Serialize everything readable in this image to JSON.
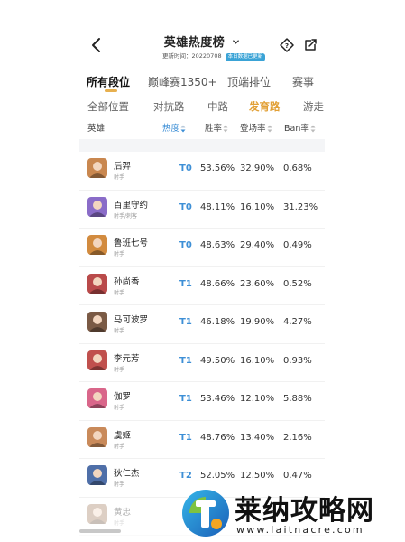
{
  "header": {
    "title": "英雄热度榜",
    "update_label": "更新时间：20220708",
    "tag": "本日数据已更新"
  },
  "rank_tabs": [
    "所有段位",
    "巅峰赛1350+",
    "顶端排位",
    "赛事"
  ],
  "position_tabs": [
    "全部位置",
    "对抗路",
    "中路",
    "发育路",
    "游走"
  ],
  "columns": {
    "hero": "英雄",
    "heat": "热度",
    "win_rate": "胜率",
    "pick_rate": "登场率",
    "ban_rate": "Ban率"
  },
  "rows": [
    {
      "name": "后羿",
      "role": "射手",
      "tier": "T0",
      "win": "53.56%",
      "pick": "32.90%",
      "ban": "0.68%",
      "avatar_color": "#c9874f"
    },
    {
      "name": "百里守约",
      "role": "射手/刺客",
      "tier": "T0",
      "win": "48.11%",
      "pick": "16.10%",
      "ban": "31.23%",
      "avatar_color": "#8a6cc8"
    },
    {
      "name": "鲁班七号",
      "role": "射手",
      "tier": "T0",
      "win": "48.63%",
      "pick": "29.40%",
      "ban": "0.49%",
      "avatar_color": "#d28b3f"
    },
    {
      "name": "孙尚香",
      "role": "射手",
      "tier": "T1",
      "win": "48.66%",
      "pick": "23.60%",
      "ban": "0.52%",
      "avatar_color": "#b94a4a"
    },
    {
      "name": "马可波罗",
      "role": "射手",
      "tier": "T1",
      "win": "46.18%",
      "pick": "19.90%",
      "ban": "4.27%",
      "avatar_color": "#7a5a45"
    },
    {
      "name": "李元芳",
      "role": "射手",
      "tier": "T1",
      "win": "49.50%",
      "pick": "16.10%",
      "ban": "0.93%",
      "avatar_color": "#c0504d"
    },
    {
      "name": "伽罗",
      "role": "射手",
      "tier": "T1",
      "win": "53.46%",
      "pick": "12.10%",
      "ban": "5.88%",
      "avatar_color": "#d9668a"
    },
    {
      "name": "虞姬",
      "role": "射手",
      "tier": "T1",
      "win": "48.76%",
      "pick": "13.40%",
      "ban": "2.16%",
      "avatar_color": "#c98a5a"
    },
    {
      "name": "狄仁杰",
      "role": "射手",
      "tier": "T2",
      "win": "52.05%",
      "pick": "12.50%",
      "ban": "0.47%",
      "avatar_color": "#4f6fa8"
    },
    {
      "name": "黄忠",
      "role": "射手",
      "tier": "",
      "win": "",
      "pick": "",
      "ban": "",
      "avatar_color": "#a0785a"
    }
  ],
  "watermark": {
    "title": "莱纳攻略网",
    "url": "www.laitnacre.com"
  },
  "colors": {
    "accent_gold": "#e2a036",
    "tier_blue": "#3d8fd6"
  }
}
